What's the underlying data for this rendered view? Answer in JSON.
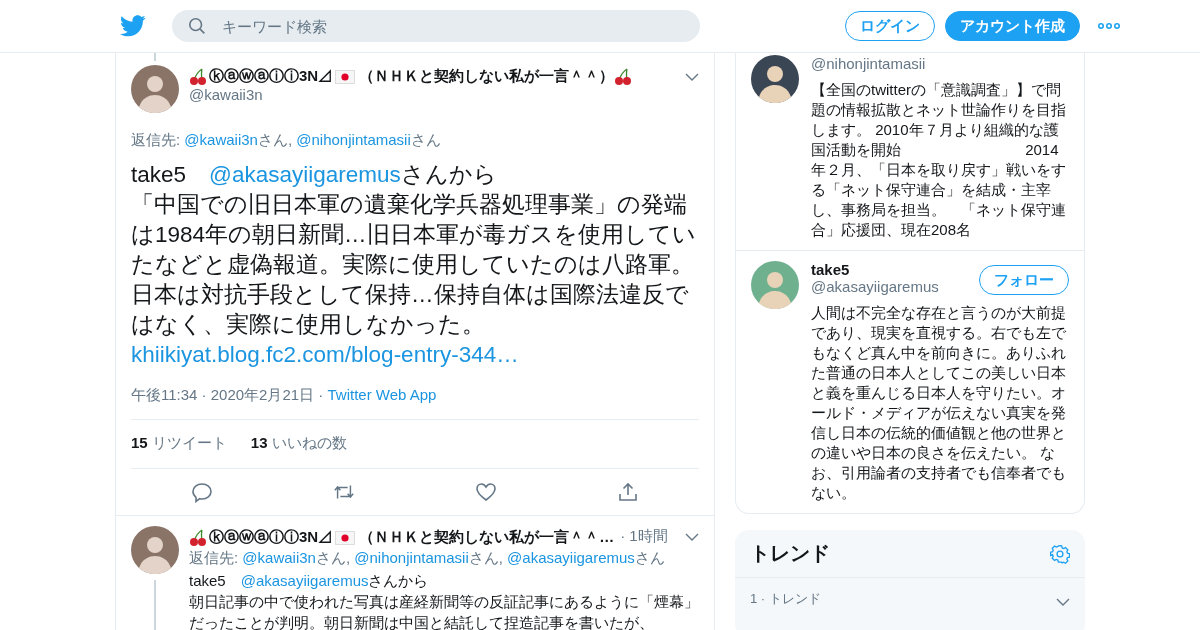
{
  "header": {
    "search": {
      "placeholder": "キーワード検索"
    },
    "login": "ログイン",
    "signup": "アカウント作成"
  },
  "main_tweet": {
    "name_parts": [
      {
        "kind": "cherry"
      },
      {
        "kind": "text",
        "text": "ⓚⓐⓦⓐⓘⓘ3N⊿"
      },
      {
        "kind": "flag"
      },
      {
        "kind": "text",
        "text": "（ＮＨＫと契約しない私が一言＾＾）"
      },
      {
        "kind": "cherry"
      }
    ],
    "handle": "@kawaii3n",
    "reply_to": [
      {
        "kind": "text",
        "text": "返信先: "
      },
      {
        "kind": "link",
        "text": "@kawaii3n"
      },
      {
        "kind": "text",
        "text": "さん, "
      },
      {
        "kind": "link",
        "text": "@nihonjintamasii"
      },
      {
        "kind": "text",
        "text": "さん"
      }
    ],
    "body": [
      {
        "kind": "text",
        "text": "take5　"
      },
      {
        "kind": "link",
        "text": "@akasayiigaremus"
      },
      {
        "kind": "text",
        "text": "さんから"
      },
      {
        "kind": "break"
      },
      {
        "kind": "text",
        "text": "「中国での旧日本軍の遺棄化学兵器処理事業」の発端は1984年の朝日新聞…旧日本軍が毒ガスを使用していたなどと虚偽報道。実際に使用していたのは八路軍。日本は対抗手段として保持…保持自体は国際法違反ではなく、実際に使用しなかった。"
      },
      {
        "kind": "break"
      },
      {
        "kind": "link",
        "text": "khiikiyat.blog.fc2.com/blog-entry-344…"
      }
    ],
    "time": "午後11:34 · 2020年2月21日 · ",
    "source": "Twitter Web App",
    "stats": [
      {
        "count": "15",
        "label": "リツイート"
      },
      {
        "count": "13",
        "label": "いいねの数"
      }
    ]
  },
  "reply_tweet": {
    "name_parts": [
      {
        "kind": "cherry"
      },
      {
        "kind": "text",
        "text": "ⓚⓐⓦⓐⓘⓘ3N⊿"
      },
      {
        "kind": "flag"
      },
      {
        "kind": "text",
        "text": "（ＮＨＫと契約しない私が一言＾＾…"
      }
    ],
    "time": "· 1時間",
    "reply_to": [
      {
        "kind": "text",
        "text": "返信先: "
      },
      {
        "kind": "link",
        "text": "@kawaii3n"
      },
      {
        "kind": "text",
        "text": "さん, "
      },
      {
        "kind": "link",
        "text": "@nihonjintamasii"
      },
      {
        "kind": "text",
        "text": "さん, "
      },
      {
        "kind": "link",
        "text": "@akasayiigaremus"
      },
      {
        "kind": "text",
        "text": "さん"
      }
    ],
    "body": [
      {
        "kind": "text",
        "text": "take5　"
      },
      {
        "kind": "link",
        "text": "@akasayiigaremus"
      },
      {
        "kind": "text",
        "text": "さんから"
      },
      {
        "kind": "break"
      },
      {
        "kind": "text",
        "text": "朝日記事の中で使われた写真は産経新聞等の反証記事にあるように「煙幕」だったことが判明。朝日新聞は中国と結託して捏造記事を書いたが、"
      }
    ]
  },
  "profiles": [
    {
      "handle": "@nihonjintamasii",
      "bio": "【全国のtwitterの「意識調査」】で問題の情報拡散とネット世論作りを目指します。 2010年７月より組織的な護国活動を開始　　　　　　　　 2014年２月、「日本を取り戻す」戦いをする「ネット保守連合」を結成・主宰し、事務局を担当。　「ネット保守連合」応援団、現在208名"
    },
    {
      "name": "take5",
      "handle": "@akasayiigaremus",
      "follow": "フォロー",
      "bio": "人間は不完全な存在と言うのが大前提であり、現実を直視する。右でも左でもなくど真ん中を前向きに。ありふれた普通の日本人としてこの美しい日本と義を重んじる日本人を守りたい。オールド・メディアが伝えない真実を発信し日本の伝統的価値観と他の世界との違いや日本の良さを伝えたい。 なお、引用論者の支持者でも信奉者でもない。"
    }
  ],
  "trends": {
    "title": "トレンド",
    "items": [
      {
        "meta": "1 · トレンド"
      }
    ]
  }
}
